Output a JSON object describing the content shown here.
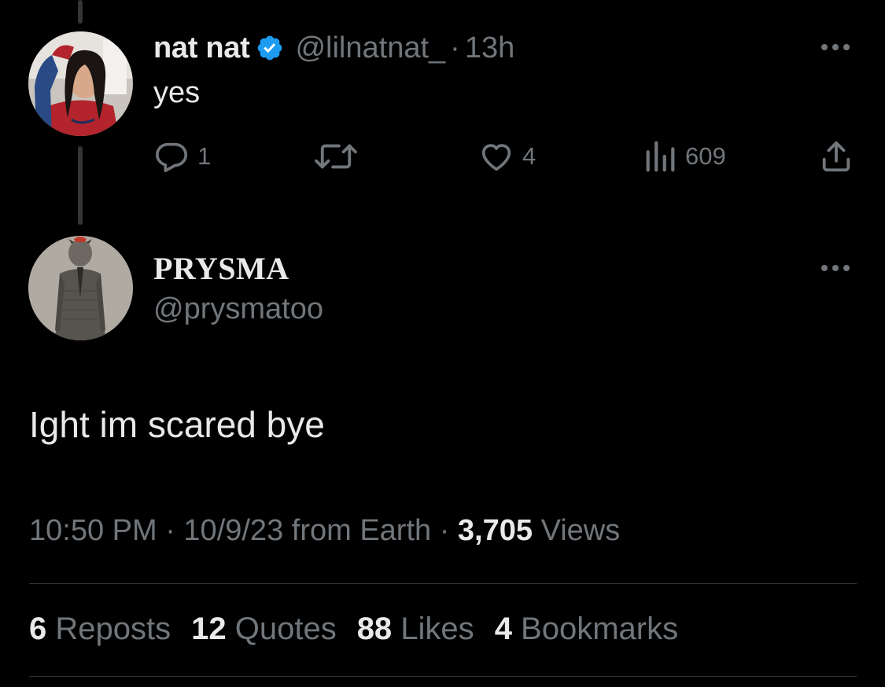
{
  "parent_tweet": {
    "display_name": "nat nat",
    "handle": "@lilnatnat_",
    "separator": "·",
    "time": "13h",
    "text": "yes",
    "actions": {
      "reply_count": "1",
      "like_count": "4",
      "views_count": "609"
    }
  },
  "main_tweet": {
    "display_name": "PRYSMA",
    "handle": "@prysmatoo",
    "text": "Ight im scared bye",
    "timestamp": "10:50 PM · 10/9/23 from Earth · ",
    "views_count": "3,705",
    "views_label": " Views"
  },
  "stats": {
    "reposts": {
      "count": "6",
      "label": " Reposts"
    },
    "quotes": {
      "count": "12",
      "label": " Quotes"
    },
    "likes": {
      "count": "88",
      "label": " Likes"
    },
    "bookmarks": {
      "count": "4",
      "label": " Bookmarks"
    }
  },
  "colors": {
    "background": "#000000",
    "primary_text": "#e7e9ea",
    "secondary_text": "#71767b",
    "verified_blue": "#1d9bf0",
    "divider": "#2f3336"
  },
  "icons": [
    "verified-badge-icon",
    "more-icon",
    "reply-icon",
    "repost-icon",
    "like-icon",
    "views-icon",
    "share-icon"
  ]
}
